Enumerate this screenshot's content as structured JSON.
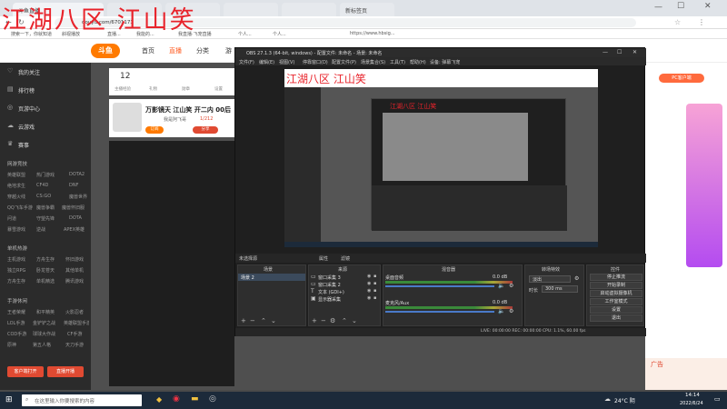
{
  "overlay": {
    "title": "江湖八区  江山笑"
  },
  "browser": {
    "tabs": [
      "斗鱼直播",
      "",
      "",
      "",
      "",
      "新标签页"
    ],
    "address": "douyu.com/6701173",
    "bookmarks": [
      "搜索一下，你就知道",
      "斜视播放",
      "直播...",
      "我能的...",
      "我直播·飞宠直播",
      "个人...",
      "个人...",
      "https://www.hbsig..."
    ]
  },
  "site": {
    "logo": "斗鱼",
    "nav": [
      "首页",
      "直播",
      "分类",
      "游"
    ],
    "pc_client": "PC客户端"
  },
  "sidebar": {
    "items": [
      "我的关注",
      "排行榜",
      "页游中心",
      "云游戏",
      "赛事"
    ],
    "section1": "网游竞技",
    "section1_items": [
      "英雄联盟",
      "热门游戏",
      "DOTA2",
      "绝地求生",
      "CF4D",
      "DNF",
      "穿越火线",
      "CS:GO",
      "魔兽世界",
      "QQ飞车手游",
      "魔兽争霸",
      "魔兽怀旧服",
      "问道",
      "守望先锋",
      "DOTA",
      "暴雪游戏",
      "逆战",
      "APEX英雄"
    ],
    "section2": "单机热游",
    "section2_items": [
      "主机游戏",
      "方舟生存",
      "怀旧游戏",
      "独立RPG",
      "卧龙苍天",
      "其他单机",
      "方舟生存",
      "单机精选",
      "腾讯游戏"
    ],
    "section3": "手游休闲",
    "section3_items": [
      "王者荣耀",
      "和平精英",
      "火影忍者",
      "LOL手游",
      "金铲铲之战",
      "英雄联盟手游",
      "COD手游",
      "球球大作战",
      "CF手游",
      "原神",
      "第五人格",
      "天刀手游"
    ],
    "footer_left": "客户端打开",
    "footer_right": "直播开播"
  },
  "streamer": {
    "stats": [
      "12"
    ],
    "stat_labels": [
      "主播经验",
      "礼物",
      "勋章",
      "设置"
    ],
    "title": "万影镜天 江山笑 开二内 00后",
    "name": "我是阿飞哥",
    "level": "1/212",
    "follow": "订阅",
    "share": "分享"
  },
  "obs": {
    "title": "OBS 27.1.3 (64-bit, windows) - 配置文件: 未命名 - 场景: 未命名",
    "menu": [
      "文件(F)",
      "编辑(E)",
      "视图(V)",
      "停靠窗口(D)",
      "配置文件(P)",
      "场景集合(S)",
      "工具(T)",
      "帮助(H)",
      "设备: 弹幕飞宠"
    ],
    "preview_overlay": "江湖八区  江山笑",
    "inner_overlay": "江湖八区 江山笑",
    "scene_bar": "未选择源",
    "scene_bar_props": "属性",
    "scene_bar_filters": "滤镜",
    "scenes_title": "场景",
    "scenes": [
      "场景 2"
    ],
    "sources_title": "来源",
    "sources": [
      "窗口采集 3",
      "窗口采集 2",
      "文本 (GDI+)",
      "显示器采集"
    ],
    "mixer_title": "混音器",
    "mixer_channels": [
      {
        "name": "桌面音频",
        "db": "0.0 dB"
      },
      {
        "name": "麦克风/Aux",
        "db": "0.0 dB"
      }
    ],
    "transition_title": "转场特效",
    "transition_type": "淡出",
    "transition_duration_label": "时长",
    "transition_duration": "300 ms",
    "controls_title": "控件",
    "controls": [
      "停止推流",
      "开始录制",
      "启动虚拟摄像机",
      "工作室模式",
      "设置",
      "退出"
    ],
    "status": "LIVE: 00:00:00   REC: 00:00:00   CPU: 1.1%, 60.00 fps"
  },
  "taskbar": {
    "search_placeholder": "在这里输入你要搜索的内容",
    "weather": "24°C 阴",
    "time": "14:14",
    "date": "2022/6/24"
  },
  "ad": {
    "label": "广告"
  }
}
